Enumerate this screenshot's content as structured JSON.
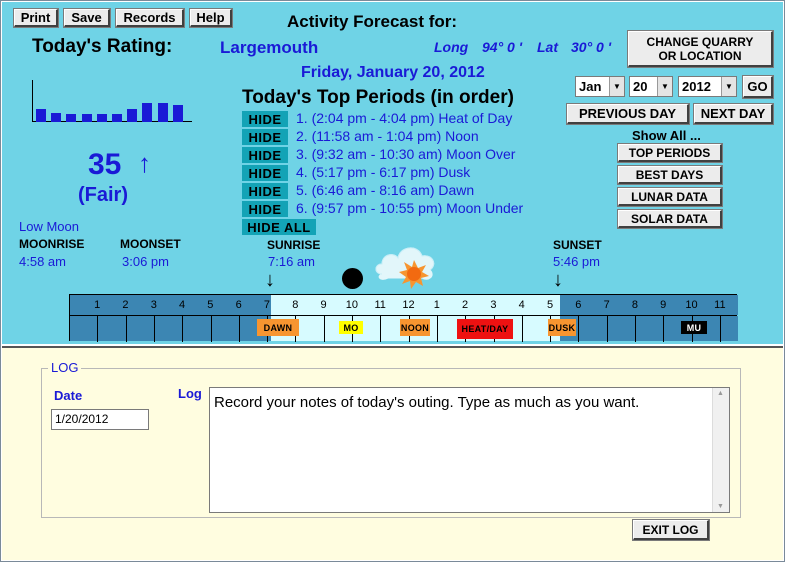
{
  "toolbar": {
    "print_label": "Print",
    "save_label": "Save",
    "records_label": "Records",
    "help_label": "Help"
  },
  "header": {
    "forecast_title": "Activity Forecast for:",
    "rating_label": "Today's Rating:",
    "species": "Largemouth",
    "long_label": "Long",
    "long_value": "94° 0 '",
    "lat_label": "Lat",
    "lat_value": "30° 0 '",
    "date": "Friday, January 20, 2012",
    "change_location_label": "CHANGE QUARRY OR LOCATION"
  },
  "rating": {
    "score": "35",
    "trend_arrow": "↑",
    "quality": "(Fair)",
    "bar_levels": [
      0.3,
      0.22,
      0.18,
      0.18,
      0.2,
      0.2,
      0.3,
      0.45,
      0.45,
      0.41
    ]
  },
  "date_picker": {
    "month": "Jan",
    "day": "20",
    "year": "2012",
    "go_label": "GO",
    "previous_day_label": "PREVIOUS DAY",
    "next_day_label": "NEXT DAY"
  },
  "top_periods": {
    "heading": "Today's Top Periods (in order)",
    "hide_label": "HIDE",
    "hide_all_label": "HIDE ALL",
    "items": [
      "1. (2:04 pm - 4:04 pm) Heat of Day",
      "2. (11:58 am - 1:04 pm) Noon",
      "3. (9:32 am - 10:30 am) Moon Over",
      "4. (5:17 pm - 6:17 pm) Dusk",
      "5. (6:46 am - 8:16 am) Dawn",
      "6. (9:57 pm - 10:55 pm) Moon Under"
    ]
  },
  "show_all": {
    "label": "Show All ...",
    "top_periods_label": "TOP PERIODS",
    "best_days_label": "BEST DAYS",
    "lunar_data_label": "LUNAR DATA",
    "solar_data_label": "SOLAR DATA"
  },
  "astro": {
    "moon_phase": "Low Moon",
    "moonrise_label": "MOONRISE",
    "moonrise_time": "4:58 am",
    "moonset_label": "MOONSET",
    "moonset_time": "3:06 pm",
    "sunrise_label": "SUNRISE",
    "sunrise_time": "7:16 am",
    "sunset_label": "SUNSET",
    "sunset_time": "5:46 pm",
    "sunrise_arrow": "↓",
    "sunset_arrow": "↓"
  },
  "timeline": {
    "hours": [
      "1",
      "2",
      "3",
      "4",
      "5",
      "6",
      "7",
      "8",
      "9",
      "10",
      "11",
      "12",
      "1",
      "2",
      "3",
      "4",
      "5",
      "6",
      "7",
      "8",
      "9",
      "10",
      "11"
    ],
    "events": {
      "dawn": "DAWN",
      "moon_over": "MO",
      "noon": "NOON",
      "heat_of_day": "HEAT/DAY",
      "dusk": "DUSK",
      "moon_under": "MU"
    },
    "colors": {
      "night": "#3c86b3",
      "day": "#d7fbff",
      "dawn": "#f79530",
      "moon_over": "#ffff00",
      "noon": "#f79530",
      "heat_of_day": "#ee1111",
      "dusk": "#f79530",
      "moon_under": "#000000"
    }
  },
  "log": {
    "group_title": "LOG",
    "date_label": "Date",
    "date_value": "1/20/2012",
    "log_label": "Log",
    "notes": "Record your notes of today's outing.  Type as much as you want.",
    "exit_label": "EXIT LOG"
  },
  "colors": {
    "panel_bg": "#6fd3e6",
    "log_bg": "#fffde0",
    "accent_blue": "#1a1ad6",
    "hide_bg": "#13a3b6"
  }
}
